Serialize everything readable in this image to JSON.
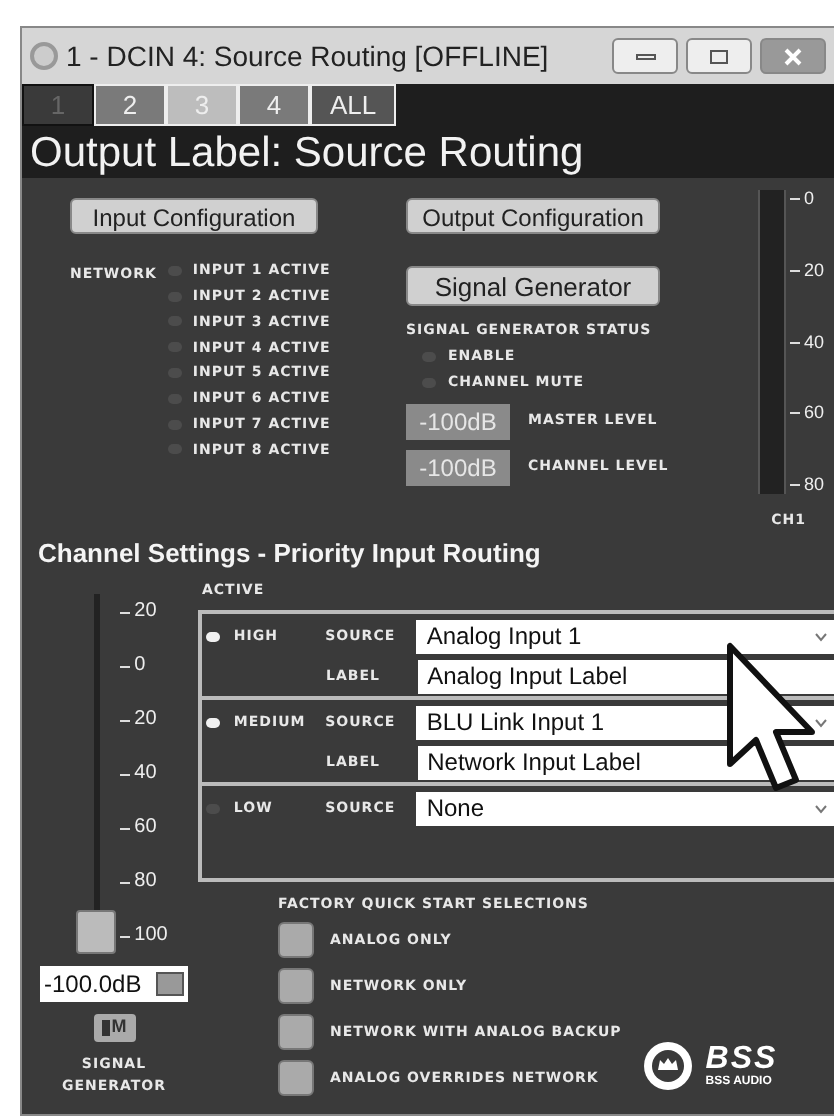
{
  "window": {
    "title": "1 - DCIN 4: Source Routing [OFFLINE]"
  },
  "tabs": [
    {
      "label": "1",
      "selected": true,
      "color": "#3a3a3a"
    },
    {
      "label": "2",
      "selected": false,
      "color": "#7a7a7a"
    },
    {
      "label": "3",
      "selected": false,
      "color": "#bdbdbd"
    },
    {
      "label": "4",
      "selected": false,
      "color": "#7a7a7a"
    },
    {
      "label": "ALL",
      "selected": false,
      "color": "#555555"
    }
  ],
  "header": "Output Label: Source Routing",
  "buttons": [
    "Input Configuration",
    "Output Configuration"
  ],
  "network": {
    "label": "NETWORK",
    "inputs": [
      {
        "label": "INPUT 1 ACTIVE",
        "on": false
      },
      {
        "label": "INPUT 2 ACTIVE",
        "on": false
      },
      {
        "label": "INPUT 3 ACTIVE",
        "on": false
      },
      {
        "label": "INPUT 4 ACTIVE",
        "on": false
      },
      {
        "label": "INPUT 5 ACTIVE",
        "on": false
      },
      {
        "label": "INPUT 6 ACTIVE",
        "on": false
      },
      {
        "label": "INPUT 7 ACTIVE",
        "on": false
      },
      {
        "label": "INPUT 8 ACTIVE",
        "on": false
      }
    ]
  },
  "signal_generator": {
    "button": "Signal Generator",
    "status_title": "SIGNAL GENERATOR STATUS",
    "status": [
      {
        "label": "ENABLE",
        "on": false
      },
      {
        "label": "CHANNEL MUTE",
        "on": false
      }
    ],
    "levels": [
      {
        "value": "-100dB",
        "label": "MASTER LEVEL"
      },
      {
        "value": "-100dB",
        "label": "CHANNEL LEVEL"
      }
    ]
  },
  "meter": {
    "ticks": [
      "0",
      "20",
      "40",
      "60",
      "80"
    ],
    "channel": "CH1"
  },
  "channel_settings": {
    "title": "Channel Settings - Priority Input Routing",
    "active_label": "ACTIVE",
    "priorities": [
      {
        "name": "HIGH",
        "active": true,
        "source_label": "SOURCE",
        "source": "Analog Input 1",
        "label_label": "LABEL",
        "label": "Analog Input Label"
      },
      {
        "name": "MEDIUM",
        "active": true,
        "source_label": "SOURCE",
        "source": "BLU Link Input 1",
        "label_label": "LABEL",
        "label": "Network Input Label"
      },
      {
        "name": "LOW",
        "active": false,
        "source_label": "SOURCE",
        "source": "None"
      }
    ]
  },
  "quick_start": {
    "title": "FACTORY QUICK START SELECTIONS",
    "options": [
      "ANALOG ONLY",
      "NETWORK ONLY",
      "NETWORK WITH ANALOG BACKUP",
      "ANALOG OVERRIDES NETWORK"
    ]
  },
  "fader": {
    "ticks": [
      "20",
      "0",
      "20",
      "40",
      "60",
      "80",
      "100"
    ],
    "level": 0,
    "value": "-100.0dB",
    "mute": "M",
    "caption": "SIGNAL GENERATOR"
  },
  "logo": {
    "mark": "BSS",
    "text": "BSS AUDIO"
  }
}
